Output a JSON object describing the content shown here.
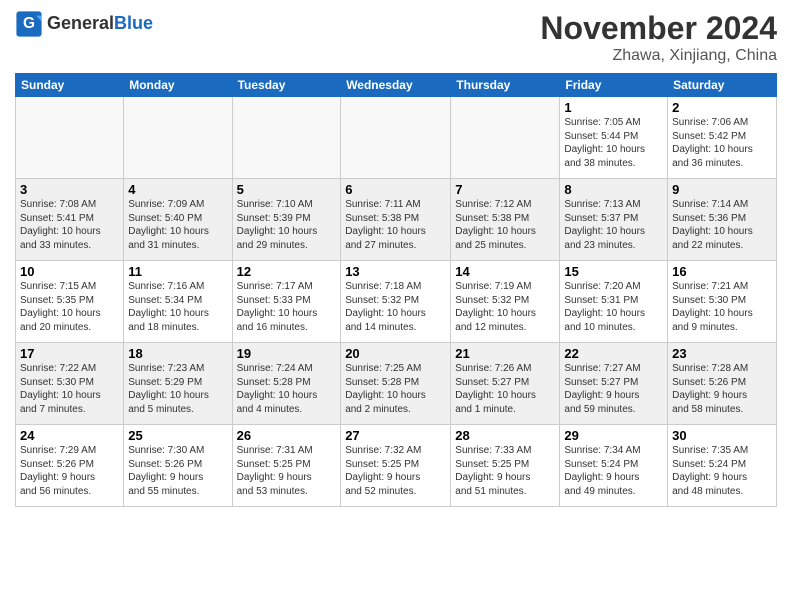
{
  "header": {
    "logo_general": "General",
    "logo_blue": "Blue",
    "month_title": "November 2024",
    "location": "Zhawa, Xinjiang, China"
  },
  "weekdays": [
    "Sunday",
    "Monday",
    "Tuesday",
    "Wednesday",
    "Thursday",
    "Friday",
    "Saturday"
  ],
  "weeks": [
    [
      {
        "day": "",
        "info": ""
      },
      {
        "day": "",
        "info": ""
      },
      {
        "day": "",
        "info": ""
      },
      {
        "day": "",
        "info": ""
      },
      {
        "day": "",
        "info": ""
      },
      {
        "day": "1",
        "info": "Sunrise: 7:05 AM\nSunset: 5:44 PM\nDaylight: 10 hours\nand 38 minutes."
      },
      {
        "day": "2",
        "info": "Sunrise: 7:06 AM\nSunset: 5:42 PM\nDaylight: 10 hours\nand 36 minutes."
      }
    ],
    [
      {
        "day": "3",
        "info": "Sunrise: 7:08 AM\nSunset: 5:41 PM\nDaylight: 10 hours\nand 33 minutes."
      },
      {
        "day": "4",
        "info": "Sunrise: 7:09 AM\nSunset: 5:40 PM\nDaylight: 10 hours\nand 31 minutes."
      },
      {
        "day": "5",
        "info": "Sunrise: 7:10 AM\nSunset: 5:39 PM\nDaylight: 10 hours\nand 29 minutes."
      },
      {
        "day": "6",
        "info": "Sunrise: 7:11 AM\nSunset: 5:38 PM\nDaylight: 10 hours\nand 27 minutes."
      },
      {
        "day": "7",
        "info": "Sunrise: 7:12 AM\nSunset: 5:38 PM\nDaylight: 10 hours\nand 25 minutes."
      },
      {
        "day": "8",
        "info": "Sunrise: 7:13 AM\nSunset: 5:37 PM\nDaylight: 10 hours\nand 23 minutes."
      },
      {
        "day": "9",
        "info": "Sunrise: 7:14 AM\nSunset: 5:36 PM\nDaylight: 10 hours\nand 22 minutes."
      }
    ],
    [
      {
        "day": "10",
        "info": "Sunrise: 7:15 AM\nSunset: 5:35 PM\nDaylight: 10 hours\nand 20 minutes."
      },
      {
        "day": "11",
        "info": "Sunrise: 7:16 AM\nSunset: 5:34 PM\nDaylight: 10 hours\nand 18 minutes."
      },
      {
        "day": "12",
        "info": "Sunrise: 7:17 AM\nSunset: 5:33 PM\nDaylight: 10 hours\nand 16 minutes."
      },
      {
        "day": "13",
        "info": "Sunrise: 7:18 AM\nSunset: 5:32 PM\nDaylight: 10 hours\nand 14 minutes."
      },
      {
        "day": "14",
        "info": "Sunrise: 7:19 AM\nSunset: 5:32 PM\nDaylight: 10 hours\nand 12 minutes."
      },
      {
        "day": "15",
        "info": "Sunrise: 7:20 AM\nSunset: 5:31 PM\nDaylight: 10 hours\nand 10 minutes."
      },
      {
        "day": "16",
        "info": "Sunrise: 7:21 AM\nSunset: 5:30 PM\nDaylight: 10 hours\nand 9 minutes."
      }
    ],
    [
      {
        "day": "17",
        "info": "Sunrise: 7:22 AM\nSunset: 5:30 PM\nDaylight: 10 hours\nand 7 minutes."
      },
      {
        "day": "18",
        "info": "Sunrise: 7:23 AM\nSunset: 5:29 PM\nDaylight: 10 hours\nand 5 minutes."
      },
      {
        "day": "19",
        "info": "Sunrise: 7:24 AM\nSunset: 5:28 PM\nDaylight: 10 hours\nand 4 minutes."
      },
      {
        "day": "20",
        "info": "Sunrise: 7:25 AM\nSunset: 5:28 PM\nDaylight: 10 hours\nand 2 minutes."
      },
      {
        "day": "21",
        "info": "Sunrise: 7:26 AM\nSunset: 5:27 PM\nDaylight: 10 hours\nand 1 minute."
      },
      {
        "day": "22",
        "info": "Sunrise: 7:27 AM\nSunset: 5:27 PM\nDaylight: 9 hours\nand 59 minutes."
      },
      {
        "day": "23",
        "info": "Sunrise: 7:28 AM\nSunset: 5:26 PM\nDaylight: 9 hours\nand 58 minutes."
      }
    ],
    [
      {
        "day": "24",
        "info": "Sunrise: 7:29 AM\nSunset: 5:26 PM\nDaylight: 9 hours\nand 56 minutes."
      },
      {
        "day": "25",
        "info": "Sunrise: 7:30 AM\nSunset: 5:26 PM\nDaylight: 9 hours\nand 55 minutes."
      },
      {
        "day": "26",
        "info": "Sunrise: 7:31 AM\nSunset: 5:25 PM\nDaylight: 9 hours\nand 53 minutes."
      },
      {
        "day": "27",
        "info": "Sunrise: 7:32 AM\nSunset: 5:25 PM\nDaylight: 9 hours\nand 52 minutes."
      },
      {
        "day": "28",
        "info": "Sunrise: 7:33 AM\nSunset: 5:25 PM\nDaylight: 9 hours\nand 51 minutes."
      },
      {
        "day": "29",
        "info": "Sunrise: 7:34 AM\nSunset: 5:24 PM\nDaylight: 9 hours\nand 49 minutes."
      },
      {
        "day": "30",
        "info": "Sunrise: 7:35 AM\nSunset: 5:24 PM\nDaylight: 9 hours\nand 48 minutes."
      }
    ]
  ]
}
